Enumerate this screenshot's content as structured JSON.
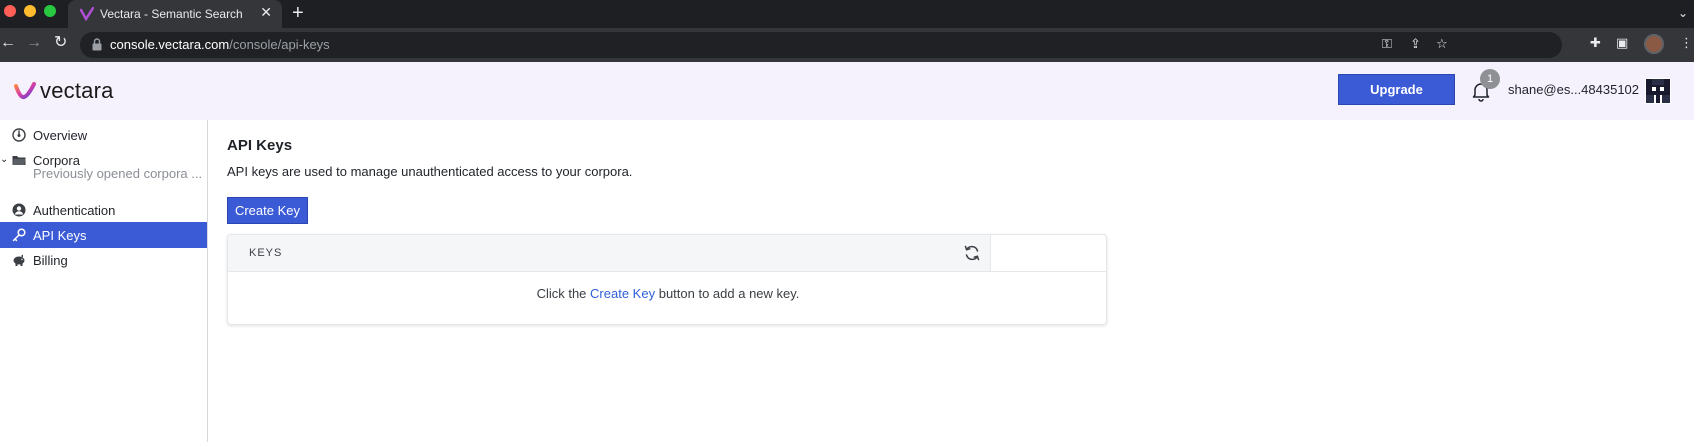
{
  "browser": {
    "tab_title": "Vectara - Semantic Search",
    "url_host": "console.vectara.com",
    "url_path": "/console/api-keys"
  },
  "header": {
    "logo_text": "vectara",
    "upgrade_label": "Upgrade",
    "notification_count": "1",
    "user_email": "shane@es...48435102"
  },
  "sidebar": {
    "items": [
      {
        "label": "Overview",
        "icon": "overview-icon"
      },
      {
        "label": "Corpora",
        "icon": "folder-icon"
      },
      {
        "label": "Previously opened corpora ..."
      },
      {
        "label": "Authentication",
        "icon": "user-circle-icon"
      },
      {
        "label": "API Keys",
        "icon": "key-icon",
        "active": true
      },
      {
        "label": "Billing",
        "icon": "piggy-bank-icon"
      }
    ]
  },
  "main": {
    "title": "API Keys",
    "description": "API keys are used to manage unauthenticated access to your corpora.",
    "create_button": "Create Key",
    "table": {
      "column": "KEYS",
      "empty_prefix": "Click the",
      "empty_link": "Create Key",
      "empty_suffix": "button to add a new key."
    }
  },
  "colors": {
    "accent": "#3b5bd6",
    "header_bg": "#f6f2fd",
    "link": "#2f5fd8"
  }
}
